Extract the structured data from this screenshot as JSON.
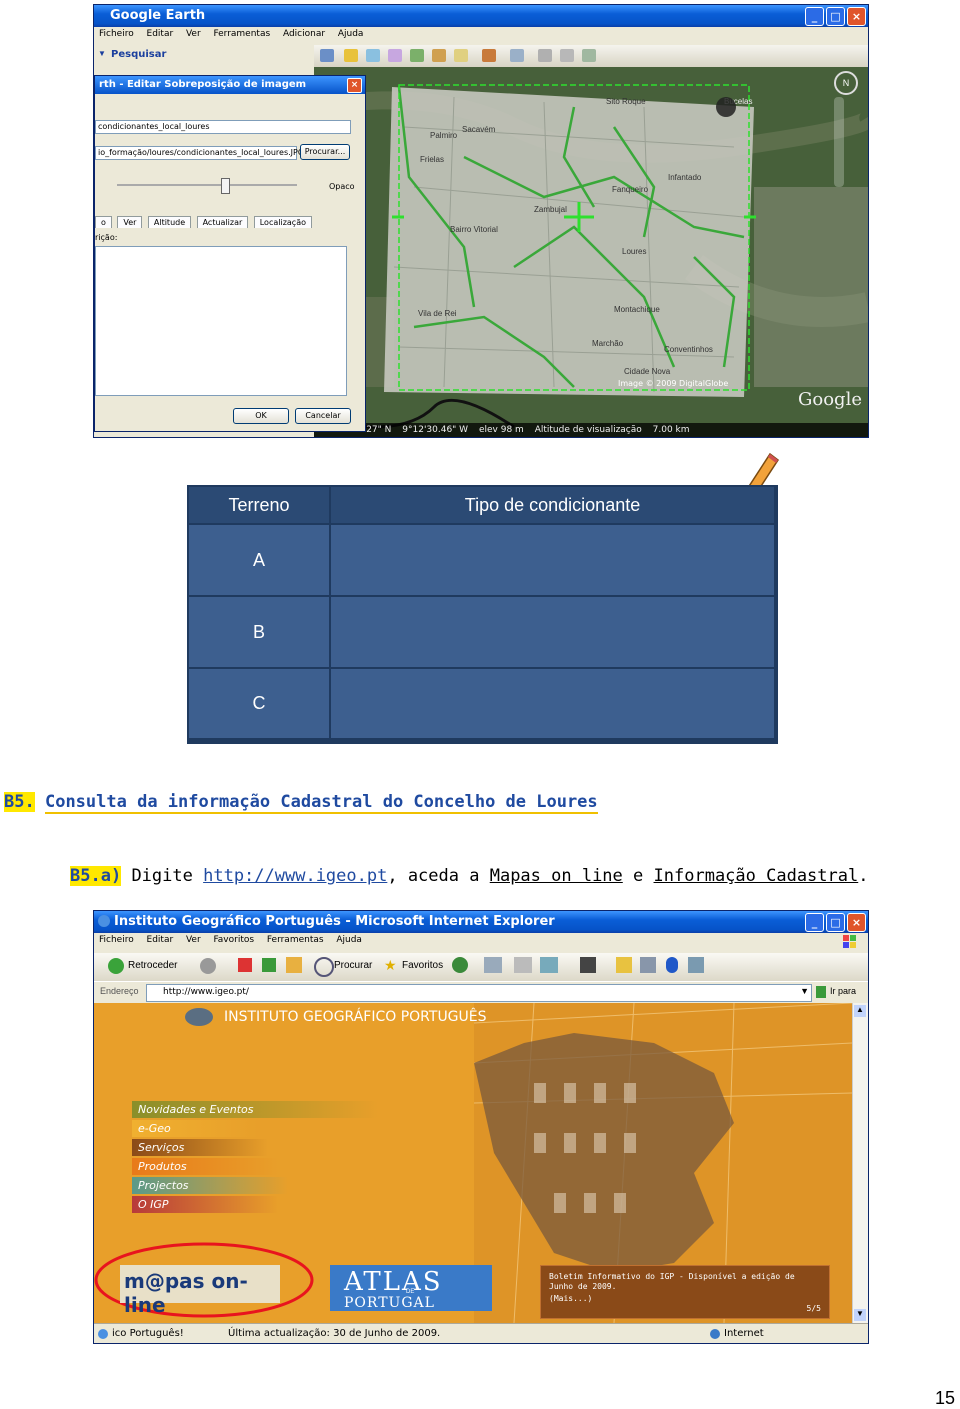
{
  "google_earth": {
    "title": "Google Earth",
    "menu": [
      "Ficheiro",
      "Editar",
      "Ver",
      "Ferramentas",
      "Adicionar",
      "Ajuda"
    ],
    "search_label": "Pesquisar",
    "dialog": {
      "title": "rth - Editar Sobreposição de imagem",
      "name_value": "condicionantes_local_loures",
      "link_value": "io_formação/loures/condicionantes_local_loures.JPG",
      "browse_label": "Procurar...",
      "opacity_label": "Opaco",
      "tabs": [
        "o",
        "Ver",
        "Altitude",
        "Actualizar",
        "Localização"
      ],
      "description_label": "rição:",
      "ok_label": "OK",
      "cancel_label": "Cancelar"
    },
    "map_labels": [
      "Sito Roque",
      "Sacavém",
      "Palmiro",
      "Frielas",
      "Zambujal",
      "Loures",
      "Bairro Vitorial",
      "Fanqueiro",
      "Infantado",
      "Montachique",
      "Vila de Rei",
      "Bucelas",
      "Marchão",
      "Conventinhos",
      "Cidade Nova"
    ],
    "copyright": "Image © 2009 DigitalGlobe",
    "brand": "Google",
    "status": {
      "lat": "38°50'12.27\" N",
      "lon": "9°12'30.46\" W",
      "elev": "elev   98 m",
      "view_altitude": "Altitude de visualização",
      "distance": "7.00 km"
    }
  },
  "table": {
    "headers": [
      "Terreno",
      "Tipo de condicionante"
    ],
    "rows": [
      {
        "terreno": "A",
        "tipo": ""
      },
      {
        "terreno": "B",
        "tipo": ""
      },
      {
        "terreno": "C",
        "tipo": ""
      }
    ]
  },
  "section": {
    "code": "B5.",
    "title": "Consulta da informação Cadastral do Concelho de Loures"
  },
  "step": {
    "code": "B5.a)",
    "text_before": "Digite",
    "url": "http://www.igeo.pt",
    "text_middle": ", aceda a",
    "link1": "Mapas on line",
    "text_and": "e",
    "link2": "Informação Cadastral",
    "text_end": "."
  },
  "ie": {
    "title": "Instituto Geográfico Português - Microsoft Internet Explorer",
    "menu": [
      "Ficheiro",
      "Editar",
      "Ver",
      "Favoritos",
      "Ferramentas",
      "Ajuda"
    ],
    "back_label": "Retroceder",
    "search_label": "Procurar",
    "favorites_label": "Favoritos",
    "address_label": "Endereço",
    "address_value": "http://www.igeo.pt/",
    "go_label": "Ir para",
    "site_title": "INSTITUTO GEOGRÁFICO PORTUGUÊS",
    "nav": [
      "Novidades e Eventos",
      "e-Geo",
      "Serviços",
      "Produtos",
      "Projectos",
      "O IGP"
    ],
    "mapas_label": "m@pas on-line",
    "atlas_label": "ATLAS",
    "atlas_small": "DE",
    "atlas_sub": "PORTUGAL",
    "news": "Boletim Informativo do IGP - Disponível a edição de Junho de 2009.",
    "news_more": "(Mais...)",
    "news_page": "5/5",
    "status_left": "ico Português!",
    "status_update": "Última actualização: 30 de Junho de 2009.",
    "status_zone": "Internet"
  },
  "page_number": "15"
}
